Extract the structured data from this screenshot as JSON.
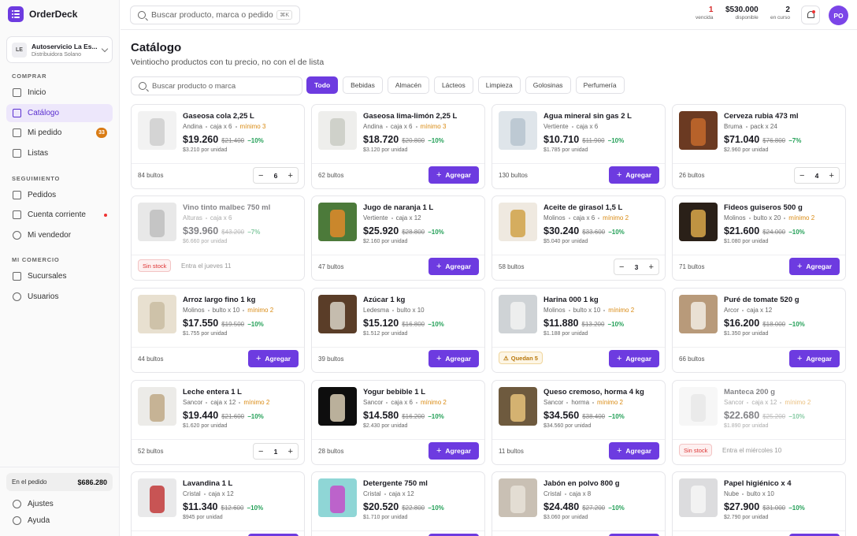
{
  "app": {
    "name": "OrderDeck"
  },
  "store": {
    "initials": "LE",
    "name": "Autoservicio La Es...",
    "sub": "Distribuidora Solano"
  },
  "sidebar": {
    "sections": [
      "COMPRAR",
      "SEGUIMIENTO",
      "MI COMERCIO"
    ],
    "items": [
      {
        "label": "Inicio",
        "icon": "home-icon"
      },
      {
        "label": "Catálogo",
        "icon": "grid-icon",
        "active": true
      },
      {
        "label": "Mi pedido",
        "icon": "cart-icon",
        "badge": "33"
      },
      {
        "label": "Listas",
        "icon": "bookmark-icon"
      },
      {
        "label": "Pedidos",
        "icon": "clipboard-icon"
      },
      {
        "label": "Cuenta corriente",
        "icon": "wallet-icon",
        "dot": true
      },
      {
        "label": "Mi vendedor",
        "icon": "user-icon"
      },
      {
        "label": "Sucursales",
        "icon": "building-icon"
      },
      {
        "label": "Usuarios",
        "icon": "users-icon"
      }
    ],
    "order_label": "En el pedido",
    "order_total": "$686.280",
    "bottom": [
      {
        "label": "Ajustes",
        "icon": "gear-icon"
      },
      {
        "label": "Ayuda",
        "icon": "help-icon"
      }
    ]
  },
  "topbar": {
    "search_placeholder": "Buscar producto, marca o pedido",
    "shortcut": "⌘K",
    "stats": [
      {
        "value": "1",
        "label": "vencida",
        "color": "#d62b2b"
      },
      {
        "value": "$530.000",
        "label": "disponible",
        "color": "#1b1b22"
      },
      {
        "value": "2",
        "label": "en curso",
        "color": "#1b1b22"
      }
    ],
    "avatar": "PO"
  },
  "catalog": {
    "title": "Catálogo",
    "subtitle": "Veintiocho productos con tu precio, no con el de lista",
    "search_placeholder": "Buscar producto o marca",
    "filters": [
      "Todo",
      "Bebidas",
      "Almacén",
      "Lácteos",
      "Limpieza",
      "Golosinas",
      "Perfumería"
    ],
    "active_filter": 0,
    "add_label": "Agregar"
  },
  "products": [
    {
      "name": "Gaseosa cola 2,25 L",
      "brand": "Andina",
      "pack": "caja x 6",
      "min": "mínimo 3",
      "price": "$19.260",
      "old": "$21.400",
      "disc": "−10%",
      "unit": "$3.210 por unidad",
      "stock": "84 bultos",
      "qty": "6",
      "img": [
        "#f2f2f2",
        "#cfcfcf"
      ]
    },
    {
      "name": "Gaseosa lima-limón 2,25 L",
      "brand": "Andina",
      "pack": "caja x 6",
      "min": "mínimo 3",
      "price": "$18.720",
      "old": "$20.800",
      "disc": "−10%",
      "unit": "$3.120 por unidad",
      "stock": "62 bultos",
      "img": [
        "#eeeeec",
        "#c9cbc4"
      ]
    },
    {
      "name": "Agua mineral sin gas 2 L",
      "brand": "Vertiente",
      "pack": "caja x 6",
      "price": "$10.710",
      "old": "$11.900",
      "disc": "−10%",
      "unit": "$1.785 por unidad",
      "stock": "130 bultos",
      "img": [
        "#dfe5ea",
        "#b7c4cf"
      ]
    },
    {
      "name": "Cerveza rubia 473 ml",
      "brand": "Bruma",
      "pack": "pack x 24",
      "price": "$71.040",
      "old": "$76.800",
      "disc": "−7%",
      "unit": "$2.960 por unidad",
      "stock": "26 bultos",
      "qty": "4",
      "img": [
        "#6b3a22",
        "#c46a2c"
      ]
    },
    {
      "name": "Vino tinto malbec 750 ml",
      "brand": "Alturas",
      "pack": "caja x 6",
      "price": "$39.960",
      "old": "$43.200",
      "disc": "−7%",
      "unit": "$6.660 por unidad",
      "out": "Sin stock",
      "restock": "Entra el jueves 11",
      "img": [
        "#d7d7d7",
        "#8c8c8c"
      ]
    },
    {
      "name": "Jugo de naranja 1 L",
      "brand": "Vertiente",
      "pack": "caja x 12",
      "price": "$25.920",
      "old": "$28.800",
      "disc": "−10%",
      "unit": "$2.160 por unidad",
      "stock": "47 bultos",
      "img": [
        "#4c7a3a",
        "#e08a2a"
      ]
    },
    {
      "name": "Aceite de girasol 1,5 L",
      "brand": "Molinos",
      "pack": "caja x 6",
      "min": "mínimo 2",
      "price": "$30.240",
      "old": "$33.600",
      "disc": "−10%",
      "unit": "$5.040 por unidad",
      "stock": "58 bultos",
      "qty": "3",
      "img": [
        "#efe9e0",
        "#d0a248"
      ]
    },
    {
      "name": "Fideos guiseros 500 g",
      "brand": "Molinos",
      "pack": "bulto x 20",
      "min": "mínimo 2",
      "price": "$21.600",
      "old": "$24.000",
      "disc": "−10%",
      "unit": "$1.080 por unidad",
      "stock": "71 bultos",
      "img": [
        "#2a2018",
        "#d9a84a"
      ]
    },
    {
      "name": "Arroz largo fino 1 kg",
      "brand": "Molinos",
      "pack": "bulto x 10",
      "min": "mínimo 2",
      "price": "$17.550",
      "old": "$19.500",
      "disc": "−10%",
      "unit": "$1.755 por unidad",
      "stock": "44 bultos",
      "img": [
        "#e8e0d0",
        "#c9bca2"
      ]
    },
    {
      "name": "Azúcar 1 kg",
      "brand": "Ledesma",
      "pack": "bulto x 10",
      "price": "$15.120",
      "old": "$16.800",
      "disc": "−10%",
      "unit": "$1.512 por unidad",
      "stock": "39 bultos",
      "img": [
        "#5a3d28",
        "#d8d2c6"
      ]
    },
    {
      "name": "Harina 000 1 kg",
      "brand": "Molinos",
      "pack": "bulto x 10",
      "min": "mínimo 2",
      "price": "$11.880",
      "old": "$13.200",
      "disc": "−10%",
      "unit": "$1.188 por unidad",
      "warn": "Quedan 5",
      "img": [
        "#cfd3d6",
        "#f2f2f2"
      ]
    },
    {
      "name": "Puré de tomate 520 g",
      "brand": "Arcor",
      "pack": "caja x 12",
      "price": "$16.200",
      "old": "$18.000",
      "disc": "−10%",
      "unit": "$1.350 por unidad",
      "stock": "66 bultos",
      "img": [
        "#b89a7a",
        "#f1ece3"
      ]
    },
    {
      "name": "Leche entera 1 L",
      "brand": "Sancor",
      "pack": "caja x 12",
      "min": "mínimo 2",
      "price": "$19.440",
      "old": "$21.600",
      "disc": "−10%",
      "unit": "$1.620 por unidad",
      "stock": "52 bultos",
      "qty": "1",
      "img": [
        "#ecebe8",
        "#bfa986"
      ]
    },
    {
      "name": "Yogur bebible 1 L",
      "brand": "Sancor",
      "pack": "caja x 6",
      "min": "mínimo 2",
      "price": "$14.580",
      "old": "$16.200",
      "disc": "−10%",
      "unit": "$2.430 por unidad",
      "stock": "28 bultos",
      "img": [
        "#0e0e0e",
        "#d8cdb4"
      ]
    },
    {
      "name": "Queso cremoso, horma 4 kg",
      "brand": "Sancor",
      "pack": "horma",
      "min": "mínimo 2",
      "price": "$34.560",
      "old": "$38.400",
      "disc": "−10%",
      "unit": "$34.560 por unidad",
      "stock": "11 bultos",
      "img": [
        "#6e5a3e",
        "#e6c27a"
      ]
    },
    {
      "name": "Manteca 200 g",
      "brand": "Sancor",
      "pack": "caja x 12",
      "min": "mínimo 2",
      "price": "$22.680",
      "old": "$25.200",
      "disc": "−10%",
      "unit": "$1.890 por unidad",
      "out": "Sin stock",
      "restock": "Entra el miércoles 10",
      "img": [
        "#f0f0f0",
        "#d6d6d6"
      ]
    },
    {
      "name": "Lavandina 1 L",
      "brand": "Cristal",
      "pack": "caja x 12",
      "price": "$11.340",
      "old": "$12.600",
      "disc": "−10%",
      "unit": "$945 por unidad",
      "img": [
        "#e9e9ea",
        "#c23a3a"
      ]
    },
    {
      "name": "Detergente 750 ml",
      "brand": "Cristal",
      "pack": "caja x 12",
      "price": "$20.520",
      "old": "$22.800",
      "disc": "−10%",
      "unit": "$1.710 por unidad",
      "img": [
        "#8fd6d6",
        "#c44fc9"
      ]
    },
    {
      "name": "Jabón en polvo 800 g",
      "brand": "Cristal",
      "pack": "caja x 8",
      "price": "$24.480",
      "old": "$27.200",
      "disc": "−10%",
      "unit": "$3.060 por unidad",
      "img": [
        "#c9c0b4",
        "#e8e2d8"
      ]
    },
    {
      "name": "Papel higiénico x 4",
      "brand": "Nube",
      "pack": "bulto x 10",
      "price": "$27.900",
      "old": "$31.000",
      "disc": "−10%",
      "unit": "$2.790 por unidad",
      "img": [
        "#dcdcde",
        "#f6f6f6"
      ]
    }
  ]
}
